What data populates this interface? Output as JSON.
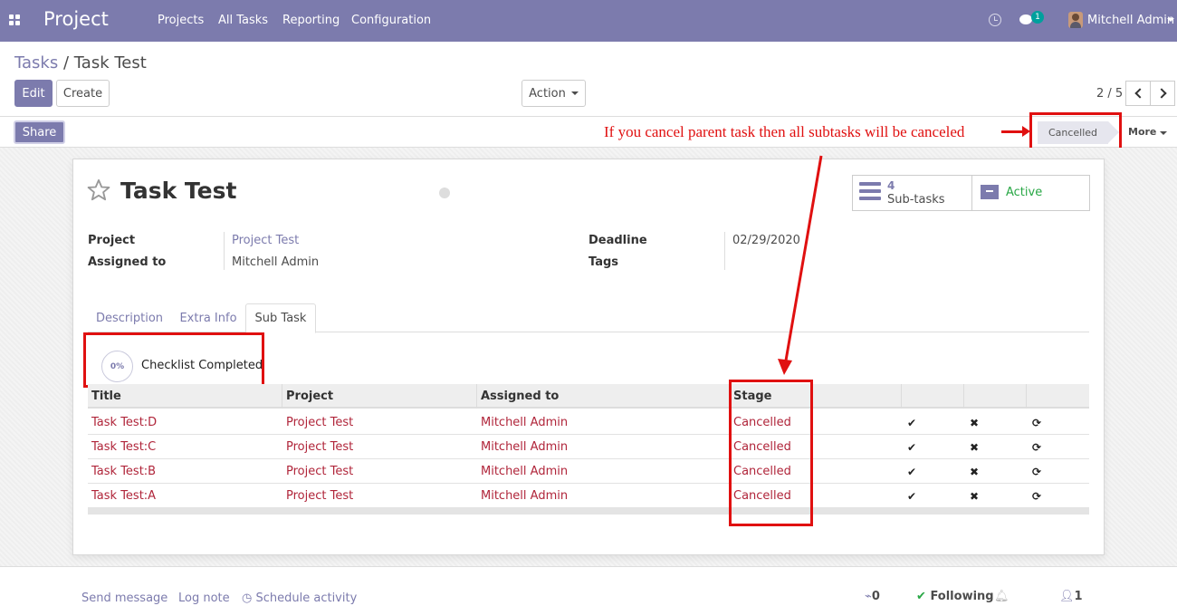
{
  "navbar": {
    "app_name": "Project",
    "menu": [
      "Projects",
      "All Tasks",
      "Reporting",
      "Configuration"
    ],
    "messages_count": "1",
    "user_name": "Mitchell Admin",
    "brand_color": "#7c7bad"
  },
  "breadcrumb": {
    "parent": "Tasks",
    "separator": "/",
    "current": "Task Test"
  },
  "toolbar": {
    "edit_label": "Edit",
    "create_label": "Create",
    "action_label": "Action",
    "pager": "2 / 5"
  },
  "statusbar": {
    "share_label": "Share",
    "annotation": "If you cancel parent task then all subtasks will be canceled",
    "stage": "Cancelled",
    "more_label": "More",
    "annotation_color": "#e01010"
  },
  "task": {
    "title": "Task Test",
    "subtasks_count": "4",
    "subtasks_label": "Sub-tasks",
    "active_label": "Active",
    "fields": {
      "project_label": "Project",
      "project_value": "Project Test",
      "assigned_label": "Assigned to",
      "assigned_value": "Mitchell Admin",
      "deadline_label": "Deadline",
      "deadline_value": "02/29/2020",
      "tags_label": "Tags"
    }
  },
  "tabs": [
    "Description",
    "Extra Info",
    "Sub Task"
  ],
  "checklist": {
    "percent": "0%",
    "label": "Checklist Completed"
  },
  "subtasks": {
    "columns": [
      "Title",
      "Project",
      "Assigned to",
      "Stage"
    ],
    "rows": [
      {
        "title": "Task Test:D",
        "project": "Project Test",
        "assigned": "Mitchell Admin",
        "stage": "Cancelled"
      },
      {
        "title": "Task Test:C",
        "project": "Project Test",
        "assigned": "Mitchell Admin",
        "stage": "Cancelled"
      },
      {
        "title": "Task Test:B",
        "project": "Project Test",
        "assigned": "Mitchell Admin",
        "stage": "Cancelled"
      },
      {
        "title": "Task Test:A",
        "project": "Project Test",
        "assigned": "Mitchell Admin",
        "stage": "Cancelled"
      }
    ],
    "icons": {
      "done": "✔",
      "cancel": "✖",
      "reset": "⟳"
    }
  },
  "chatter": {
    "send_message": "Send message",
    "log_note": "Log note",
    "schedule_activity": "Schedule activity",
    "attachments": "0",
    "following": "Following",
    "followers": "1"
  }
}
